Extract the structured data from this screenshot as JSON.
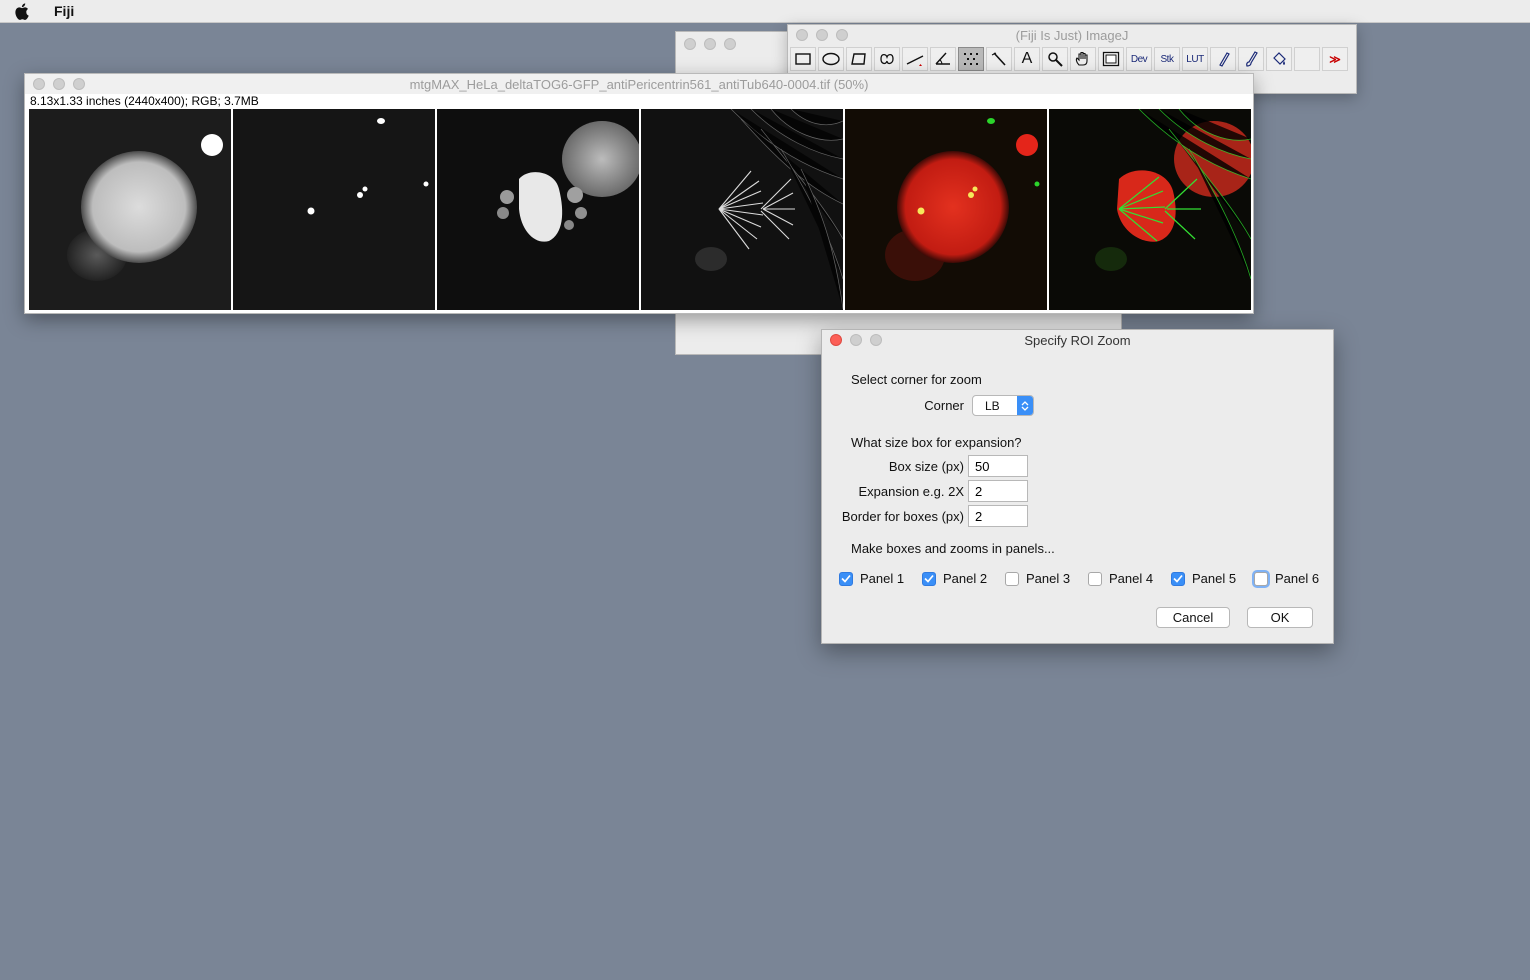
{
  "menubar": {
    "app_name": "Fiji"
  },
  "toolbar_window": {
    "title": "(Fiji Is Just) ImageJ",
    "tools": [
      {
        "name": "rectangle-tool-icon",
        "label": ""
      },
      {
        "name": "oval-tool-icon",
        "label": ""
      },
      {
        "name": "polygon-tool-icon",
        "label": ""
      },
      {
        "name": "freehand-tool-icon",
        "label": ""
      },
      {
        "name": "line-tool-icon",
        "label": ""
      },
      {
        "name": "angle-tool-icon",
        "label": ""
      },
      {
        "name": "point-tool-icon",
        "label": "",
        "selected": true
      },
      {
        "name": "wand-tool-icon",
        "label": ""
      },
      {
        "name": "text-tool-icon",
        "label": "A"
      },
      {
        "name": "magnifier-tool-icon",
        "label": ""
      },
      {
        "name": "hand-tool-icon",
        "label": ""
      },
      {
        "name": "color-picker-icon",
        "label": ""
      },
      {
        "name": "dev-menu-button",
        "label": "Dev"
      },
      {
        "name": "stk-menu-button",
        "label": "Stk"
      },
      {
        "name": "lut-menu-button",
        "label": "LUT"
      },
      {
        "name": "pencil-tool-icon",
        "label": ""
      },
      {
        "name": "brush-tool-icon",
        "label": ""
      },
      {
        "name": "flood-fill-tool-icon",
        "label": ""
      },
      {
        "name": "empty-tool-slot",
        "label": ""
      },
      {
        "name": "more-tools-button",
        "label": "≫"
      }
    ]
  },
  "image_window": {
    "title": "mtgMAX_HeLa_deltaTOG6-GFP_antiPericentrin561_antiTub640-0004.tif (50%)",
    "info": "8.13x1.33 inches (2440x400); RGB; 3.7MB",
    "panel_count": 6
  },
  "dialog": {
    "title": "Specify ROI Zoom",
    "corner_heading": "Select corner for zoom",
    "corner_label": "Corner",
    "corner_value": "LB",
    "size_heading": "What size box for expansion?",
    "box_size_label": "Box size (px)",
    "box_size_value": "50",
    "expansion_label": "Expansion e.g. 2X",
    "expansion_value": "2",
    "border_label": "Border for boxes (px)",
    "border_value": "2",
    "panels_heading": "Make boxes and zooms in panels...",
    "panels": [
      {
        "label": "Panel 1",
        "checked": true
      },
      {
        "label": "Panel 2",
        "checked": true
      },
      {
        "label": "Panel 3",
        "checked": false
      },
      {
        "label": "Panel 4",
        "checked": false
      },
      {
        "label": "Panel 5",
        "checked": true
      },
      {
        "label": "Panel 6",
        "checked": false
      }
    ],
    "cancel_label": "Cancel",
    "ok_label": "OK"
  },
  "colors": {
    "desktop": "#7a8596",
    "accent": "#3a8ff7",
    "close_red": "#fc5f57",
    "overlay_red": "#d7231b",
    "overlay_green": "#2bd42b"
  }
}
